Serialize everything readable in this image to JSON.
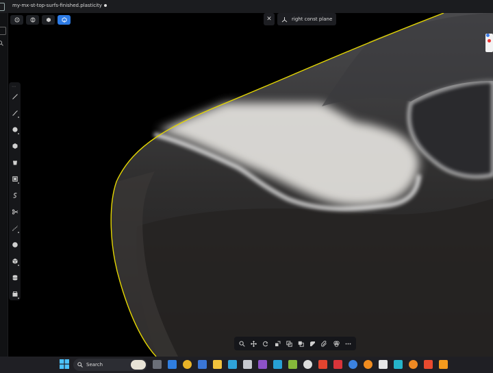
{
  "window": {
    "title": "my-mx-st-top-surfs-finished.plasticity"
  },
  "view_modes": [
    {
      "name": "wireframe",
      "active": false
    },
    {
      "name": "shaded-lines",
      "active": false
    },
    {
      "name": "shaded",
      "active": false
    },
    {
      "name": "xray",
      "active": true
    }
  ],
  "plane_panel": {
    "close_icon": "x",
    "label": "right const plane"
  },
  "left_tools": [
    "line-icon",
    "curve-icon",
    "circle-icon",
    "polygon-icon",
    "box-icon",
    "rectangle-icon",
    "spiral-icon",
    "trim-icon",
    "bezier-icon",
    "sphere-icon",
    "cube-icon",
    "cylinder-icon",
    "bucket-icon"
  ],
  "bottom_tools": [
    "search-icon",
    "move-icon",
    "rotate-icon",
    "scale-icon",
    "offset-icon",
    "boolean-icon",
    "cut-icon",
    "fillet-icon",
    "shell-icon",
    "more-icon"
  ],
  "taskbar": {
    "search_label": "Search"
  },
  "colors": {
    "accent": "#2d7be5",
    "outline": "#e5d700"
  }
}
